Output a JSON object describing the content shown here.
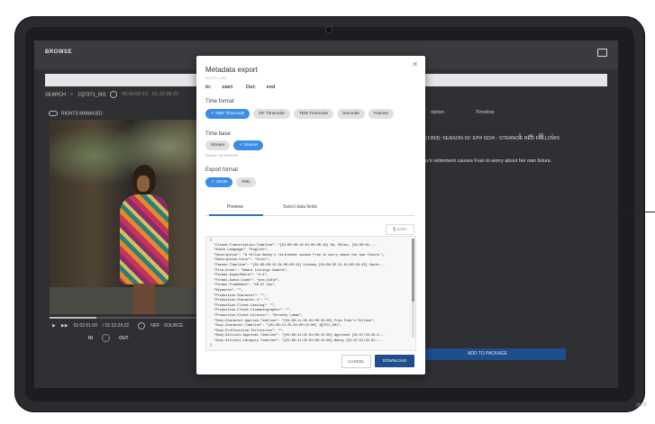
{
  "app": {
    "browse_label": "BROWSE",
    "breadcrumb": {
      "search": "SEARCH",
      "separator": ">",
      "item": "1Q7371_001",
      "timecode": "00:00:00:10 · 01:22:28:22"
    },
    "rights_label": "RIGHTS MANAGED",
    "transport": {
      "timecode": "01:02:51:00",
      "duration": "/ 01:22:29:22",
      "mode": "NDF · SOURCE"
    },
    "inout": {
      "in": "IN",
      "out": "OUT"
    },
    "right_panel": {
      "tabs": [
        "ription",
        "Timeline"
      ],
      "title": "E (1993): SEASON 02: EP# 0224 - STRANGE BED FELLOWS",
      "line1": "is.",
      "line2": "nny's retirement causes Fran to worry about her own future.",
      "line3": "ble."
    },
    "add_to_package": "ADD TO PACKAGE",
    "copyright": "ght ©"
  },
  "modal": {
    "title": "Metadata export",
    "subtitle": "1Q7371_001",
    "in_label": "In:",
    "in_value": "start",
    "out_label": "Out:",
    "out_value": "end",
    "time_format_label": "Time format",
    "time_format_options": [
      {
        "label": "✓ NDF Timecode",
        "selected": true
      },
      {
        "label": "DF Timecode",
        "selected": false
      },
      {
        "label": "TEM Timecode",
        "selected": false
      },
      {
        "label": "Seconds",
        "selected": false
      },
      {
        "label": "Frames",
        "selected": false
      }
    ],
    "time_base_label": "Time base",
    "time_base_options": [
      {
        "label": "Stream",
        "selected": false
      },
      {
        "label": "✓ Source",
        "selected": true
      }
    ],
    "source_note": "Source: 00:59:59:00",
    "export_format_label": "Export format",
    "export_format_options": [
      {
        "label": "✓ JSON",
        "selected": true
      },
      {
        "label": "XML",
        "selected": false
      }
    ],
    "tabs": {
      "preview": "Preview",
      "select": "Select data fields"
    },
    "copy_label": "⎘ COPY",
    "preview_text": "{\n  \"Closed.Transcription.Timeline\": \"[01:00:00:13-01:00:00:18] So, Miles, [01:00:01:...\n  \"Audio.Language\": \"English\",\n  \"Description\": \"A fellow Nanny's retirement causes Fran to worry about her own future.\",\n  \"Description.Color\": \"Color\",\n  \"Faceon.Timeline\": \"[01:00:00:12-01:00:00:13] Lindsay [01:00:35:11-01:00:34:13] Danie...\n  \"Film.Grant\": \"Award Listings Camera\",\n  \"Format.AspectRatio\": \"4:3\",\n  \"Format.Audio.Codec\": \"pcm_s16le\",\n  \"Format.FrameRate\": \"29.97 fps\",\n  \"Keywords\": \"\",\n  \"Production.Character\": \"\",\n  \"Production.Character.1\": \"\",\n  \"Production.Client.Casting\": \"\",\n  \"Production.Client.Cinematographer\": \"\",\n  \"Production.Client.Director\": \"Dorothy Lyman\",\n  \"Sony.Character.Approve.Timeline\": \"[01:00:11:25-01:00:15:00] Fran Fine's Fellows\",\n  \"Sony.Character.Timeline\": \"[01:00:11:25-01:00:15:00] JQ7371_001\",\n  \"Sony.Profitonline.Territories\": \"\",\n  \"Sony.Sttlsiot.Approval.Timeline\": \"[01:00:11:25-01:00:15:00] Approved [01:07:53:25-0...\n  \"Sony.Sttlsiot.Category.Timeline\": \"[01:00:11:25-01:00:15:00] Nanny [01:07:51:25-01:...\n}",
    "cancel": "CANCEL",
    "download": "DOWNLOAD"
  }
}
